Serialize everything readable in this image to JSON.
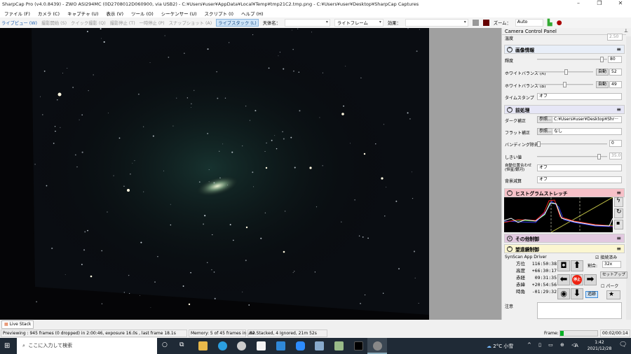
{
  "window": {
    "title": "SharpCap Pro (v4.0.8439) - ZWO ASI294MC (0D2708012D060900, via USB2) - C:¥Users¥user¥AppData¥Local¥Temp¥tmp21C2.tmp.png - C:¥Users¥user¥Desktop¥SharpCap Captures",
    "minimize": "–",
    "maximize": "❐",
    "close": "✕"
  },
  "menu": [
    "ファイル (F)",
    "カメラ (C)",
    "キャプチャ (U)",
    "表示 (V)",
    "ツール (O)",
    "シーケンサー (U)",
    "スクリプト (I)",
    "ヘルプ (H)"
  ],
  "toolbar": {
    "live_view": "ライブビュー (W)",
    "start_capture": "撮影開始 (S)",
    "quick_capture": "クイック撮影 (Q)",
    "stop_capture": "撮影停止 (T)",
    "pause": "一時停止 (P)",
    "snapshot": "スナップショット (A)",
    "live_stack": "ライブスタック (L)",
    "target_label": "天体名：",
    "target_value": "",
    "frame_type": "ライトフレーム",
    "effect_label": "効果：",
    "effect_value": "",
    "zoom_label": "ズーム：",
    "zoom_value": "Auto"
  },
  "panel": {
    "title": "Camera Control Panel",
    "top_row": {
      "label": "温度",
      "value": "2.50"
    },
    "image_info": {
      "title": "画像情報",
      "brightness": {
        "label": "輝度",
        "value": "80",
        "level": 0.95
      },
      "wb_r": {
        "label": "ホワイトバランス (R)",
        "auto": "自動",
        "value": "52",
        "level": 0.52
      },
      "wb_b": {
        "label": "ホワイトバランス (B)",
        "auto": "自動",
        "value": "49",
        "level": 0.49
      },
      "timestamp": {
        "label": "タイムスタンプ",
        "value": "オフ"
      }
    },
    "preprocess": {
      "title": "前処理",
      "dark": {
        "label": "ダーク補正",
        "browse": "参照...",
        "value": "C:¥Users¥user¥Desktop¥Shr···"
      },
      "flat": {
        "label": "フラット補正",
        "browse": "参照...",
        "value": "なし"
      },
      "banding": {
        "label": "バンディング除去",
        "value": "0",
        "level": 0
      },
      "threshold": {
        "label": "しきい値",
        "value": "35.0",
        "level": 0.9
      },
      "align": {
        "label": "自動位置合わせ\n(恒星/銀河)",
        "value": "オフ"
      },
      "bg": {
        "label": "背景減算",
        "value": "オフ"
      }
    },
    "histogram": {
      "title": "ヒストグラムストレッチ"
    },
    "other": {
      "title": "その他制御"
    },
    "telescope": {
      "title": "望遠鏡制御",
      "driver": "SynScan App Driver",
      "connected": "接続済み",
      "coords": [
        {
          "label": "方位",
          "value": "116:50:38"
        },
        {
          "label": "高度",
          "value": "+66:30:17"
        },
        {
          "label": "赤経",
          "value": "09:31:35"
        },
        {
          "label": "赤緯",
          "value": "+20:54:56"
        },
        {
          "label": "時角",
          "value": "-01:29:32"
        }
      ],
      "rate_label": "割合:",
      "rate_value": "32x",
      "setup": "セットアップ",
      "park": "パーク",
      "stop": "停止",
      "track": "追跡"
    },
    "notes_label": "注意"
  },
  "live_stack_tab": "Live Stack",
  "status": {
    "preview": "Previewing : 945 frames (0 dropped) in 2:00:46, exposure 16.0s , last frame 18.1s",
    "memory": "Memory: 5 of 45 frames in use.",
    "stacked": "82 Stacked, 4 Ignored, 21m 52s",
    "frame_label": "Frame:",
    "frame_progress": 0.1,
    "time": "00:02/00:14"
  },
  "taskbar": {
    "search_placeholder": "ここに入力して検索",
    "weather": "2°C 小雪",
    "ime": "A",
    "clock_time": "1:42",
    "clock_date": "2021/12/28"
  },
  "colors": {
    "histogram_header": "#f7c1c8",
    "other_header": "#e2c9e0",
    "telescope_header": "#fbf6d0",
    "preprocess_header": "#e6e6f6",
    "image_header": "#e8eef8"
  }
}
